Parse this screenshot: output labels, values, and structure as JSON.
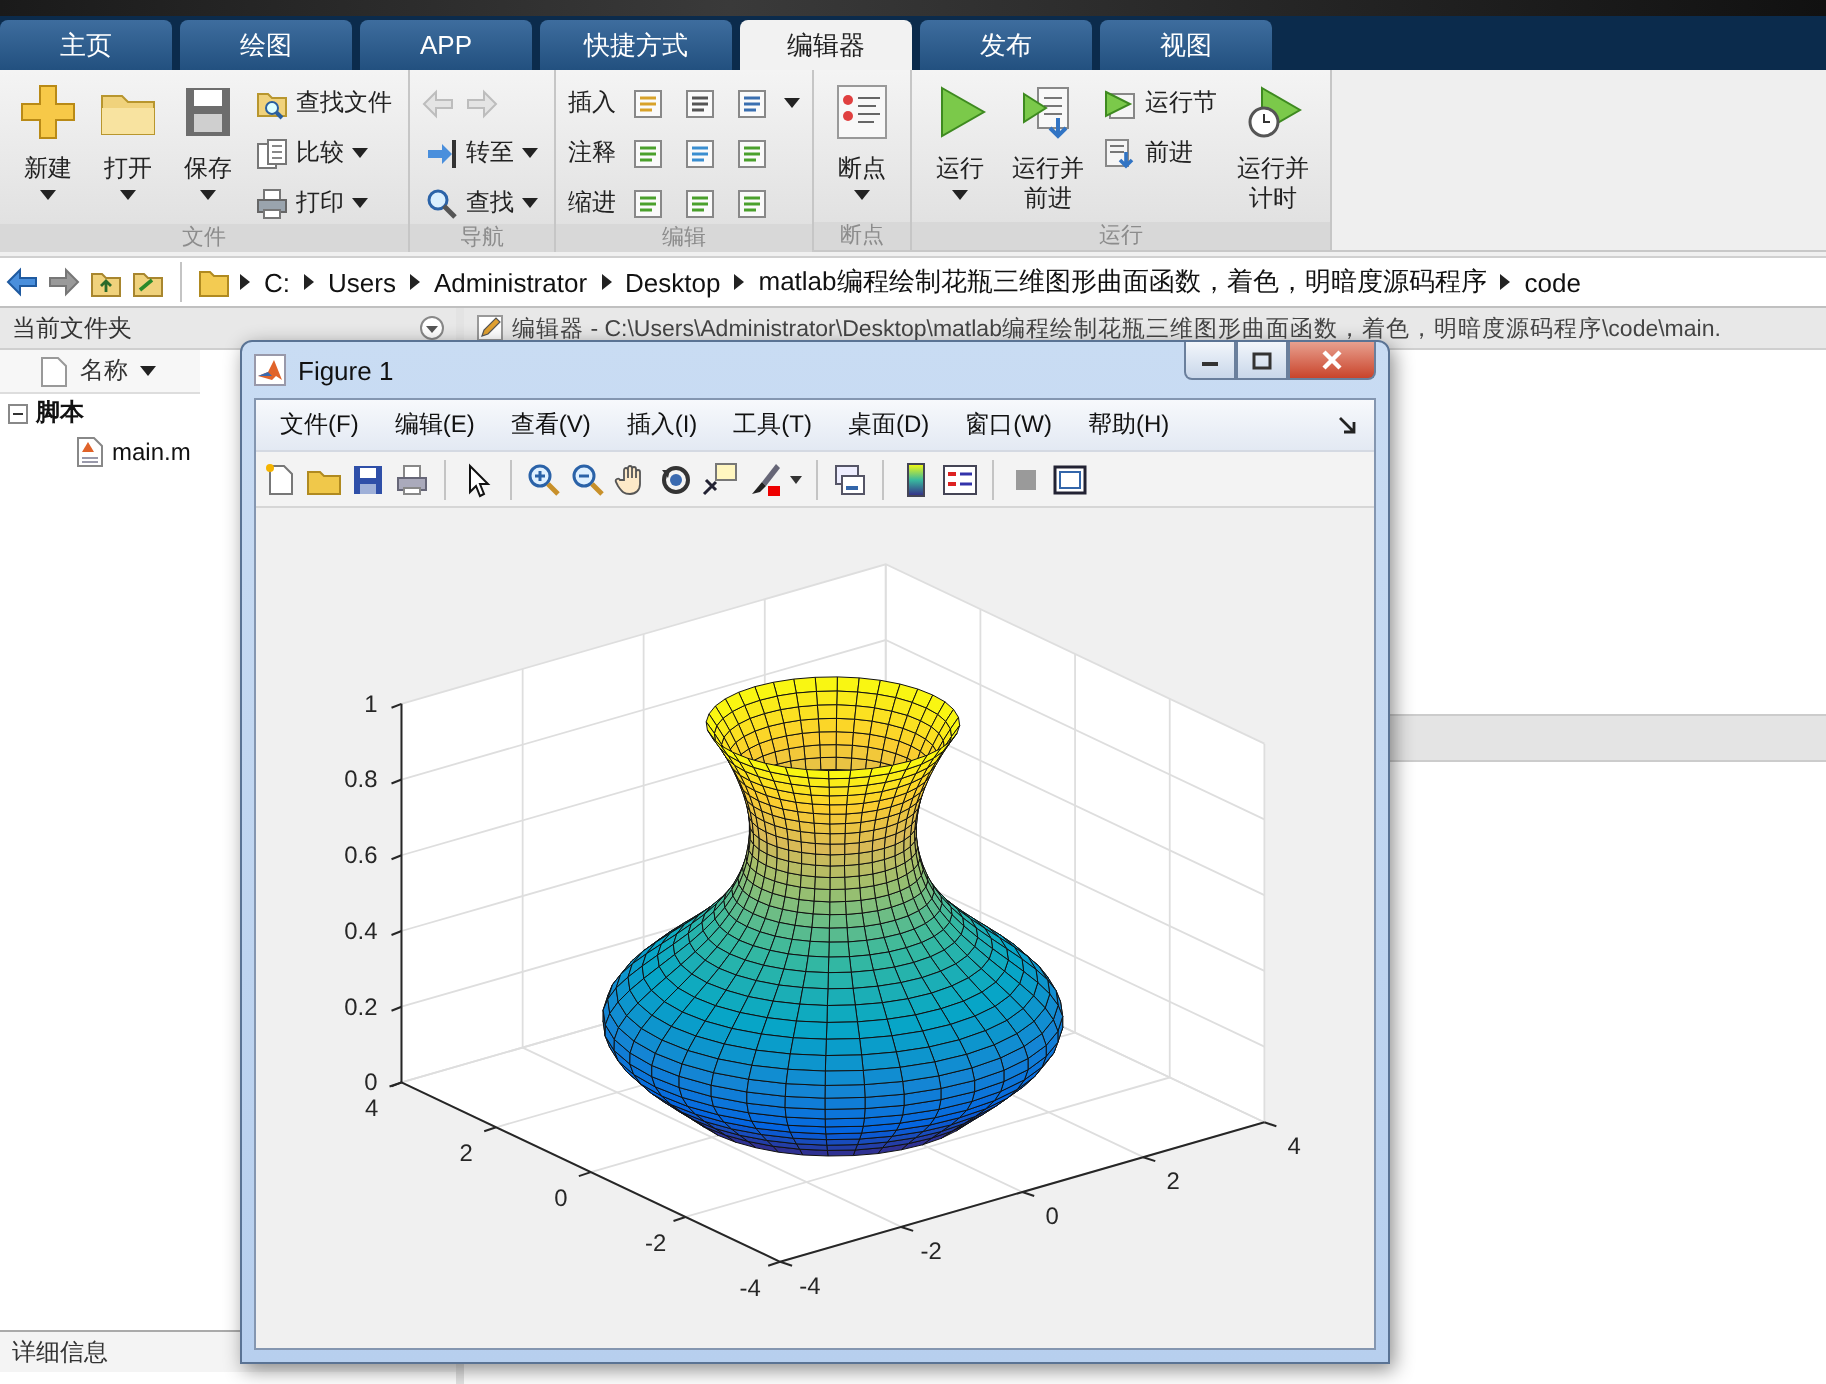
{
  "tabs": [
    {
      "label": "主页",
      "selected": false
    },
    {
      "label": "绘图",
      "selected": false
    },
    {
      "label": "APP",
      "selected": false
    },
    {
      "label": "快捷方式",
      "selected": false
    },
    {
      "label": "编辑器",
      "selected": true
    },
    {
      "label": "发布",
      "selected": false
    },
    {
      "label": "视图",
      "selected": false
    }
  ],
  "ribbon": {
    "groups": [
      {
        "title": "文件",
        "items": [
          {
            "kind": "large",
            "label": "新建",
            "dropdown": true
          },
          {
            "kind": "large",
            "label": "打开",
            "dropdown": true
          },
          {
            "kind": "large",
            "label": "保存",
            "dropdown": true
          },
          {
            "kind": "stack",
            "rows": [
              {
                "kind": "command",
                "label": "查找文件",
                "dropdown": false
              },
              {
                "kind": "command",
                "label": "比较",
                "dropdown": true
              },
              {
                "kind": "command",
                "label": "打印",
                "dropdown": true
              }
            ]
          }
        ]
      },
      {
        "title": "导航",
        "items": [
          {
            "kind": "stack",
            "rows": [
              {
                "kind": "arrows",
                "disabled": true
              },
              {
                "kind": "command",
                "label": "转至",
                "dropdown": true
              },
              {
                "kind": "command",
                "label": "查找",
                "dropdown": true
              }
            ]
          }
        ]
      },
      {
        "title": "编辑",
        "items": [
          {
            "kind": "stack",
            "rows": [
              {
                "kind": "tools",
                "label": "插入",
                "dropdown": true
              },
              {
                "kind": "tools",
                "label": "注释",
                "dropdown": false
              },
              {
                "kind": "tools",
                "label": "缩进",
                "dropdown": false
              }
            ]
          }
        ]
      },
      {
        "title": "断点",
        "items": [
          {
            "kind": "large",
            "label": "断点",
            "dropdown": true
          }
        ]
      },
      {
        "title": "运行",
        "items": [
          {
            "kind": "large",
            "label": "运行",
            "dropdown": true
          },
          {
            "kind": "large",
            "label": "运行并前进",
            "dropdown": false
          },
          {
            "kind": "stack",
            "rows": [
              {
                "kind": "command",
                "label": "运行节",
                "dropdown": false
              },
              {
                "kind": "command",
                "label": "前进",
                "dropdown": false
              }
            ]
          },
          {
            "kind": "large",
            "label": "运行并计时",
            "dropdown": false
          }
        ]
      }
    ]
  },
  "address_bar": {
    "segments": [
      "C:",
      "Users",
      "Administrator",
      "Desktop",
      "matlab编程绘制花瓶三维图形曲面函数，着色，明暗度源码程序",
      "code"
    ]
  },
  "left_panel": {
    "title": "当前文件夹",
    "column": "名称",
    "tree": [
      {
        "label": "脚本",
        "expanded": true,
        "children": [
          {
            "label": "main.m"
          }
        ]
      }
    ],
    "details": "详细信息"
  },
  "editor": {
    "title": "编辑器 - C:\\Users\\Administrator\\Desktop\\matlab编程绘制花瓶三维图形曲面函数，着色，明暗度源码程序\\code\\main."
  },
  "figure": {
    "title": "Figure 1",
    "menus": [
      "文件(F)",
      "编辑(E)",
      "查看(V)",
      "插入(I)",
      "工具(T)",
      "桌面(D)",
      "窗口(W)",
      "帮助(H)"
    ],
    "axes": {
      "z_ticks": [
        "1",
        "0.8",
        "0.6",
        "0.4",
        "0.2",
        "0"
      ],
      "y_ticks": [
        "-4",
        "-2",
        "0",
        "2",
        "4"
      ],
      "x_ticks": [
        "-4",
        "-2",
        "0",
        "2",
        "4"
      ]
    }
  }
}
